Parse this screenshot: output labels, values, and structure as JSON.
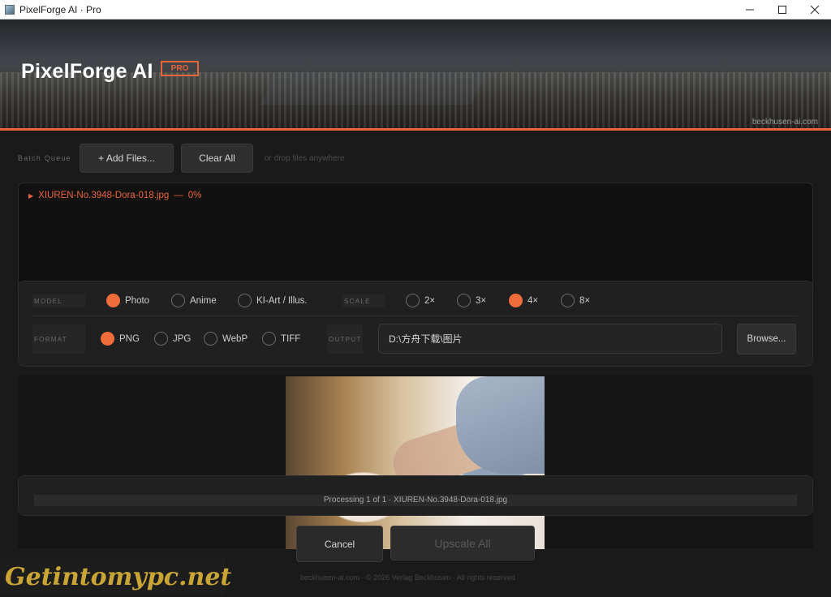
{
  "window": {
    "title": "PixelForge AI · Pro",
    "minimize_glyph": "—",
    "maximize_glyph": "☐",
    "close_glyph": "✕"
  },
  "banner": {
    "title": "PixelForge AI",
    "badge": "PRO",
    "credit": "beckhusen-ai.com"
  },
  "toolbar": {
    "queue_label": "Batch Queue",
    "add_files": "+ Add Files...",
    "clear_all": "Clear All",
    "drop_hint": "or drop files anywhere"
  },
  "queue": {
    "items": [
      {
        "name": "XIUREN-No.3948-Dora-018.jpg",
        "progress": "0%"
      }
    ]
  },
  "settings": {
    "model_label": "MODEL",
    "model_options": [
      "Photo",
      "Anime",
      "KI-Art / Illus."
    ],
    "model_selected": "Photo",
    "scale_label": "SCALE",
    "scale_options": [
      "2×",
      "3×",
      "4×",
      "8×"
    ],
    "scale_selected": "4×",
    "format_label": "FORMAT",
    "format_options": [
      "PNG",
      "JPG",
      "WebP",
      "TIFF"
    ],
    "format_selected": "PNG",
    "output_label": "OUTPUT",
    "output_path": "D:\\方舟下载\\图片",
    "browse": "Browse..."
  },
  "progress": {
    "text": "Processing 1 of 1 · XIUREN-No.3948-Dora-018.jpg",
    "fraction": 0
  },
  "actions": {
    "cancel": "Cancel",
    "upscale_all": "Upscale All"
  },
  "footer": {
    "text": "beckhusen-ai.com  ·  © 2026 Verlag Beckhusen  ·  All rights reserved"
  },
  "watermark": {
    "text": "Getintomypc.net"
  },
  "colors": {
    "accent": "#e8643a",
    "radio_on": "#ef6c3b",
    "background": "#1a1a1a"
  }
}
